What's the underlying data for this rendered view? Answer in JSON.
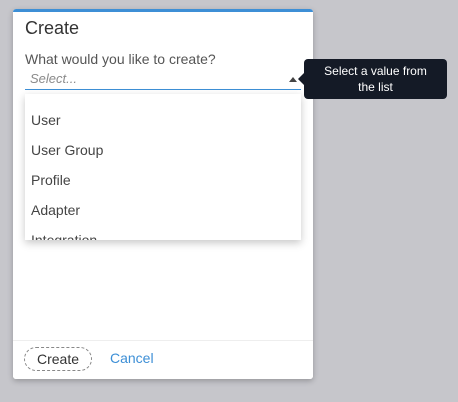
{
  "dialog": {
    "title": "Create",
    "prompt_label": "What would you like to create?",
    "select": {
      "placeholder": "Select...",
      "options": [
        "User",
        "User Group",
        "Profile",
        "Adapter",
        "Integration"
      ]
    },
    "footer": {
      "create_label": "Create",
      "cancel_label": "Cancel"
    }
  },
  "tooltip": {
    "line1": "Select a value from",
    "line2": "the list"
  },
  "colors": {
    "accent": "#3d8fd6",
    "tooltip_bg": "#141a26",
    "backdrop": "#c6c6cb"
  },
  "icons": {
    "select_caret": "caret-up-icon"
  }
}
